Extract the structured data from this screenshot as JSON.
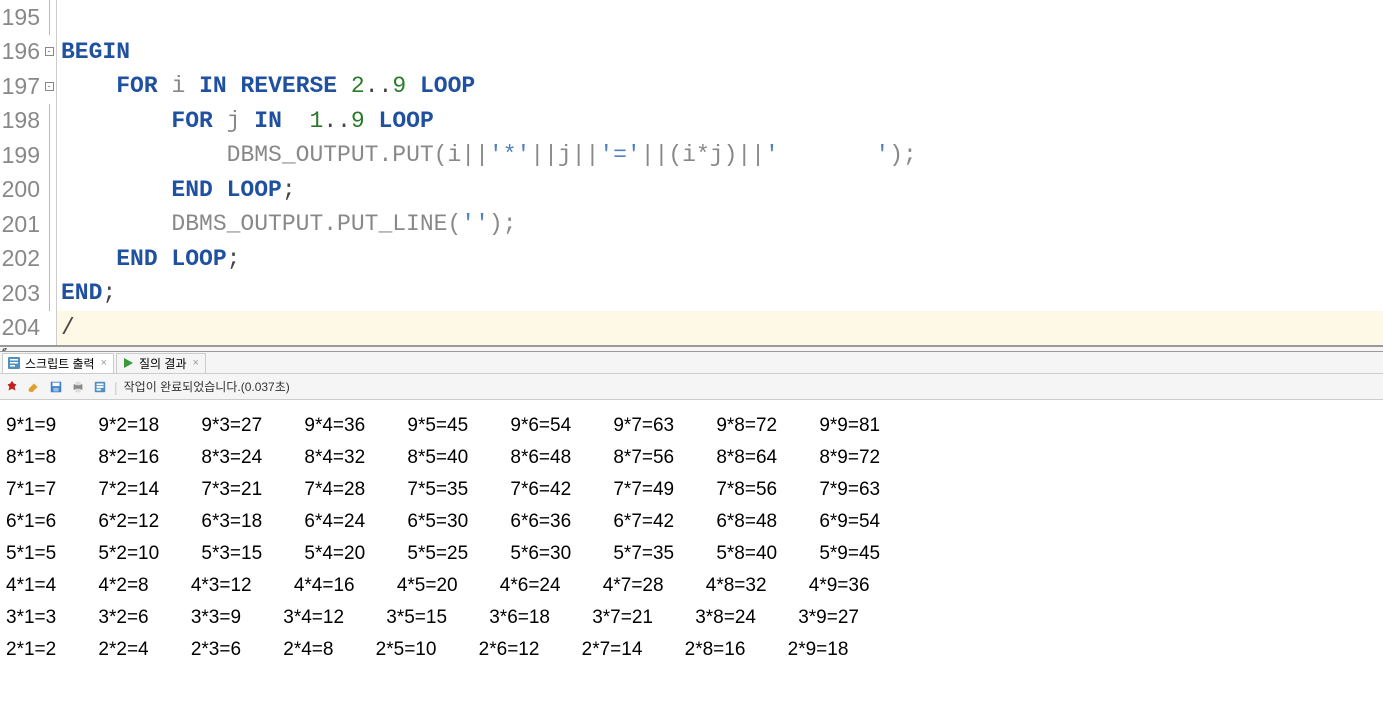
{
  "editor": {
    "lines": [
      {
        "num": "195",
        "fold": "line",
        "tokens": []
      },
      {
        "num": "196",
        "fold": "box",
        "tokens": [
          {
            "t": "kw",
            "v": "BEGIN"
          }
        ]
      },
      {
        "num": "197",
        "fold": "box",
        "tokens": [
          {
            "t": "plain",
            "v": "    "
          },
          {
            "t": "kw",
            "v": "FOR"
          },
          {
            "t": "plain",
            "v": " "
          },
          {
            "t": "ident",
            "v": "i"
          },
          {
            "t": "plain",
            "v": " "
          },
          {
            "t": "kw",
            "v": "IN REVERSE"
          },
          {
            "t": "plain",
            "v": " "
          },
          {
            "t": "num",
            "v": "2"
          },
          {
            "t": "punct",
            "v": ".."
          },
          {
            "t": "num",
            "v": "9"
          },
          {
            "t": "plain",
            "v": " "
          },
          {
            "t": "kw",
            "v": "LOOP"
          }
        ]
      },
      {
        "num": "198",
        "fold": "line",
        "tokens": [
          {
            "t": "plain",
            "v": "        "
          },
          {
            "t": "kw",
            "v": "FOR"
          },
          {
            "t": "plain",
            "v": " "
          },
          {
            "t": "ident",
            "v": "j"
          },
          {
            "t": "plain",
            "v": " "
          },
          {
            "t": "kw",
            "v": "IN"
          },
          {
            "t": "plain",
            "v": "  "
          },
          {
            "t": "num",
            "v": "1"
          },
          {
            "t": "punct",
            "v": ".."
          },
          {
            "t": "num",
            "v": "9"
          },
          {
            "t": "plain",
            "v": " "
          },
          {
            "t": "kw",
            "v": "LOOP"
          }
        ]
      },
      {
        "num": "199",
        "fold": "line",
        "tokens": [
          {
            "t": "plain",
            "v": "            "
          },
          {
            "t": "ident",
            "v": "DBMS_OUTPUT.PUT(i||"
          },
          {
            "t": "str",
            "v": "'*'"
          },
          {
            "t": "ident",
            "v": "||j||"
          },
          {
            "t": "str",
            "v": "'='"
          },
          {
            "t": "ident",
            "v": "||(i*j)||"
          },
          {
            "t": "str",
            "v": "'       '"
          },
          {
            "t": "ident",
            "v": ");"
          }
        ]
      },
      {
        "num": "200",
        "fold": "line",
        "tokens": [
          {
            "t": "plain",
            "v": "        "
          },
          {
            "t": "kw",
            "v": "END LOOP"
          },
          {
            "t": "punct",
            "v": ";"
          }
        ]
      },
      {
        "num": "201",
        "fold": "line",
        "tokens": [
          {
            "t": "plain",
            "v": "        "
          },
          {
            "t": "ident",
            "v": "DBMS_OUTPUT.PUT_LINE("
          },
          {
            "t": "str",
            "v": "''"
          },
          {
            "t": "ident",
            "v": ");"
          }
        ]
      },
      {
        "num": "202",
        "fold": "line",
        "tokens": [
          {
            "t": "plain",
            "v": "    "
          },
          {
            "t": "kw",
            "v": "END LOOP"
          },
          {
            "t": "punct",
            "v": ";"
          }
        ]
      },
      {
        "num": "203",
        "fold": "line",
        "tokens": [
          {
            "t": "kw",
            "v": "END"
          },
          {
            "t": "punct",
            "v": ";"
          }
        ]
      },
      {
        "num": "204",
        "fold": "none",
        "current": true,
        "tokens": [
          {
            "t": "punct",
            "v": "/"
          }
        ]
      }
    ]
  },
  "tabs": [
    {
      "label": "스크립트 출력",
      "icon": "script",
      "active": true
    },
    {
      "label": "질의 결과",
      "icon": "play",
      "active": false
    }
  ],
  "toolbar": {
    "status": "작업이 완료되었습니다.(0.037초)"
  },
  "output": "9*1=9        9*2=18        9*3=27        9*4=36        9*5=45        9*6=54        9*7=63        9*8=72        9*9=81       \n8*1=8        8*2=16        8*3=24        8*4=32        8*5=40        8*6=48        8*7=56        8*8=64        8*9=72       \n7*1=7        7*2=14        7*3=21        7*4=28        7*5=35        7*6=42        7*7=49        7*8=56        7*9=63       \n6*1=6        6*2=12        6*3=18        6*4=24        6*5=30        6*6=36        6*7=42        6*8=48        6*9=54       \n5*1=5        5*2=10        5*3=15        5*4=20        5*5=25        5*6=30        5*7=35        5*8=40        5*9=45       \n4*1=4        4*2=8        4*3=12        4*4=16        4*5=20        4*6=24        4*7=28        4*8=32        4*9=36       \n3*1=3        3*2=6        3*3=9        3*4=12        3*5=15        3*6=18        3*7=21        3*8=24        3*9=27       \n2*1=2        2*2=4        2*3=6        2*4=8        2*5=10        2*6=12        2*7=14        2*8=16        2*9=18       "
}
